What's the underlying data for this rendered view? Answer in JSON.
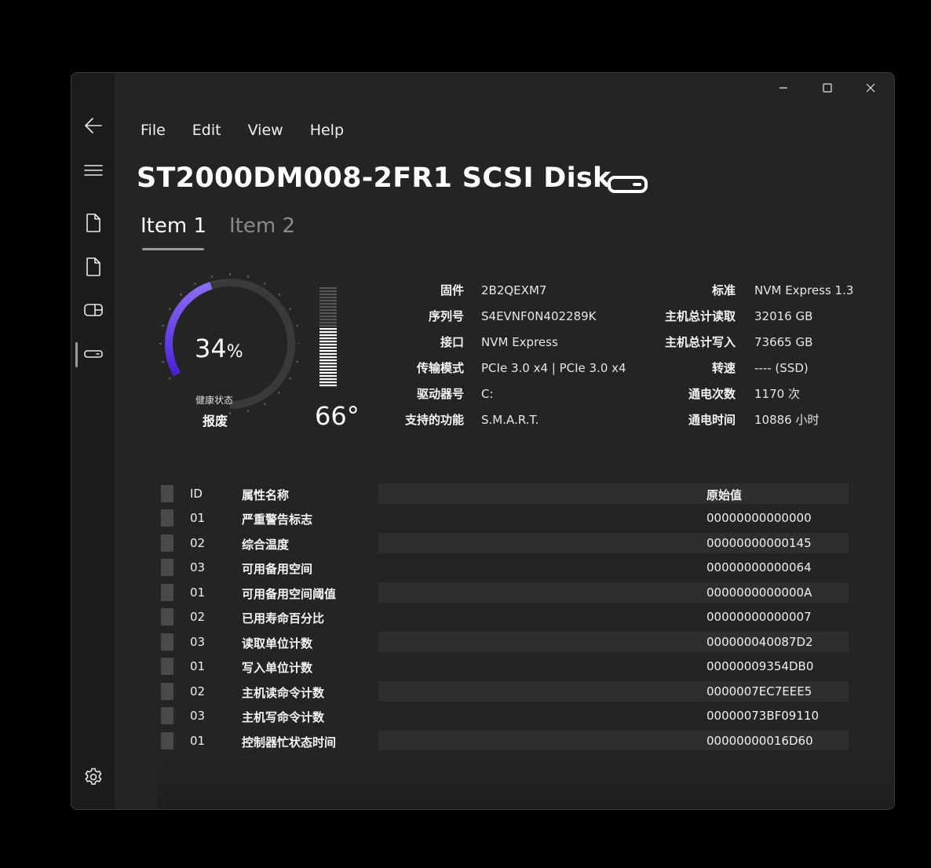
{
  "window": {
    "title": "ST2000DM008-2FR1 SCSI Disk",
    "caption": {
      "minimize_icon": "minimize-icon",
      "maximize_icon": "maximize-icon",
      "close_icon": "close-icon"
    }
  },
  "sidebar": {
    "items": [
      {
        "icon": "back-arrow-icon"
      },
      {
        "icon": "hamburger-menu-icon"
      },
      {
        "icon": "document-icon"
      },
      {
        "icon": "document-icon"
      },
      {
        "icon": "drive-icon"
      },
      {
        "icon": "disk-icon",
        "selected": true
      },
      {
        "icon": "gear-icon"
      }
    ]
  },
  "menu": {
    "file": "File",
    "edit": "Edit",
    "view": "View",
    "help": "Help"
  },
  "tabs": [
    {
      "label": "Item 1",
      "selected": true
    },
    {
      "label": "Item 2",
      "selected": false
    }
  ],
  "health": {
    "percent": 34,
    "value": "34",
    "unit": "%",
    "label": "健康状态",
    "status": "报废",
    "accent_color": "#6b47e8"
  },
  "temperature": {
    "value": "66°"
  },
  "info_left": [
    {
      "label": "固件",
      "value": "2B2QEXM7"
    },
    {
      "label": "序列号",
      "value": "S4EVNF0N402289K"
    },
    {
      "label": "接口",
      "value": "NVM Express"
    },
    {
      "label": "传输模式",
      "value": "PCIe 3.0 x4 | PCIe 3.0 x4"
    },
    {
      "label": "驱动器号",
      "value": "C:"
    },
    {
      "label": "支持的功能",
      "value": "S.M.A.R.T."
    }
  ],
  "info_right": [
    {
      "label": "标准",
      "value": "NVM Express 1.3"
    },
    {
      "label": "主机总计读取",
      "value": "32016 GB"
    },
    {
      "label": "主机总计写入",
      "value": "73665 GB"
    },
    {
      "label": "转速",
      "value": "---- (SSD)"
    },
    {
      "label": "通电次数",
      "value": "1170 次"
    },
    {
      "label": "通电时间",
      "value": "10886 小时"
    }
  ],
  "smart": {
    "headers": {
      "id": "ID",
      "name": "属性名称",
      "raw": "原始值"
    },
    "rows": [
      {
        "id": "01",
        "name": "严重警告标志",
        "raw": "00000000000000"
      },
      {
        "id": "02",
        "name": "综合温度",
        "raw": "00000000000145"
      },
      {
        "id": "03",
        "name": "可用备用空间",
        "raw": "00000000000064"
      },
      {
        "id": "01",
        "name": "可用备用空间阈值",
        "raw": "0000000000000A"
      },
      {
        "id": "02",
        "name": "已用寿命百分比",
        "raw": "00000000000007"
      },
      {
        "id": "03",
        "name": "读取单位计数",
        "raw": "000000040087D2"
      },
      {
        "id": "01",
        "name": "写入单位计数",
        "raw": "00000009354DB0"
      },
      {
        "id": "02",
        "name": "主机读命令计数",
        "raw": "0000007EC7EEE5"
      },
      {
        "id": "03",
        "name": "主机写命令计数",
        "raw": "00000073BF09110"
      },
      {
        "id": "01",
        "name": "控制器忙状态时间",
        "raw": "00000000016D60"
      }
    ]
  }
}
